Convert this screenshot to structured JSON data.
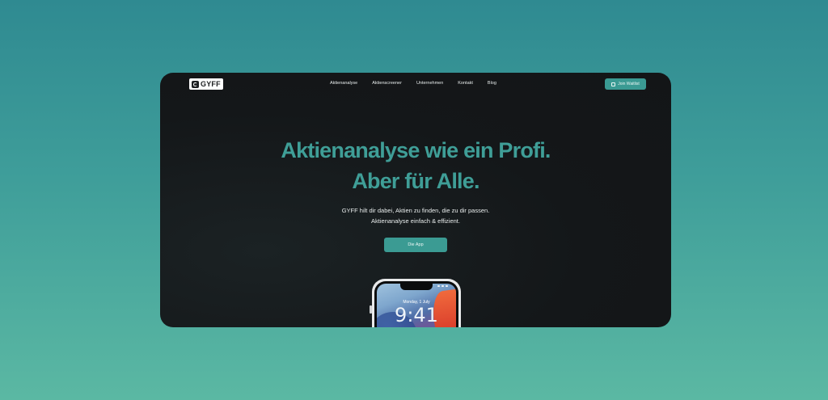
{
  "nav": {
    "logo_text": "GYFF",
    "links": [
      "Aktienanalyse",
      "Aktienscreener",
      "Unternehmen",
      "Kontakt",
      "Blog"
    ],
    "waitlist_label": "Join Waitlist"
  },
  "hero": {
    "headline_line1": "Aktienanalyse wie ein Profi.",
    "headline_line2": "Aber für Alle.",
    "sub_line1": "GYFF hilt dir dabei, Aktien zu finden, die zu dir passen.",
    "sub_line2": "Aktienanalyse einfach & effizient.",
    "cta_label": "Die App"
  },
  "phone": {
    "date": "Monday, 1 July",
    "time": "9:41"
  },
  "colors": {
    "accent": "#3f9e97",
    "button": "#3b9b93",
    "window_bg": "#141719"
  },
  "icons": {
    "logo": "gyff-logo-icon",
    "waitlist": "calendar-icon"
  }
}
